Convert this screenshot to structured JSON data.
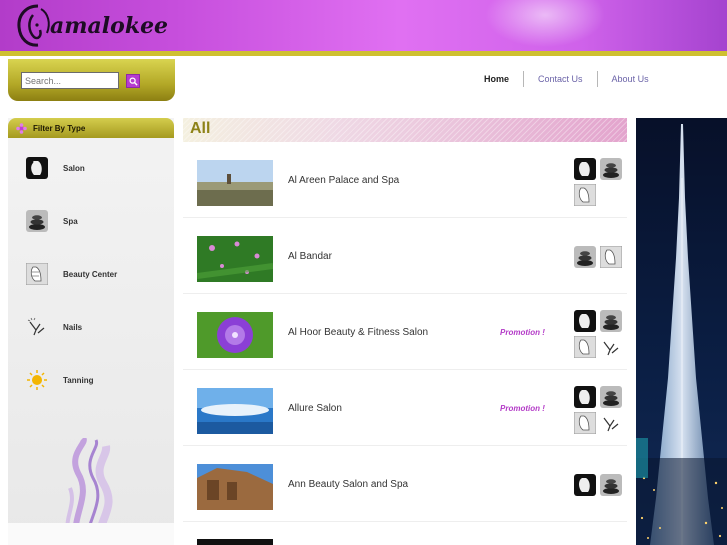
{
  "brand": {
    "name": "amalokee"
  },
  "search": {
    "placeholder": "Search..."
  },
  "nav": {
    "items": [
      {
        "label": "Home",
        "active": true
      },
      {
        "label": "Contact Us",
        "active": false
      },
      {
        "label": "About Us",
        "active": false
      }
    ]
  },
  "sidebar": {
    "title": "Filter By Type",
    "items": [
      {
        "label": "Salon",
        "icon": "salon-icon"
      },
      {
        "label": "Spa",
        "icon": "spa-stones-icon"
      },
      {
        "label": "Beauty Center",
        "icon": "beauty-center-icon"
      },
      {
        "label": "Nails",
        "icon": "nails-icon"
      },
      {
        "label": "Tanning",
        "icon": "tanning-sun-icon"
      }
    ]
  },
  "main": {
    "title": "All",
    "listings": [
      {
        "name": "Al Areen Palace and Spa",
        "promo": "",
        "types": [
          "salon",
          "spa",
          "beauty"
        ]
      },
      {
        "name": "Al Bandar",
        "promo": "",
        "types": [
          "spa",
          "beauty"
        ]
      },
      {
        "name": "Al Hoor Beauty & Fitness Salon",
        "promo": "Promotion !",
        "types": [
          "salon",
          "spa",
          "beauty",
          "nails"
        ]
      },
      {
        "name": "Allure Salon",
        "promo": "Promotion !",
        "types": [
          "salon",
          "spa",
          "beauty",
          "nails"
        ]
      },
      {
        "name": "Ann Beauty Salon and Spa",
        "promo": "",
        "types": [
          "salon",
          "spa"
        ]
      }
    ]
  },
  "colors": {
    "header": "#c74fdd",
    "accent_gold": "#cfc030",
    "promo": "#b33ac7"
  }
}
